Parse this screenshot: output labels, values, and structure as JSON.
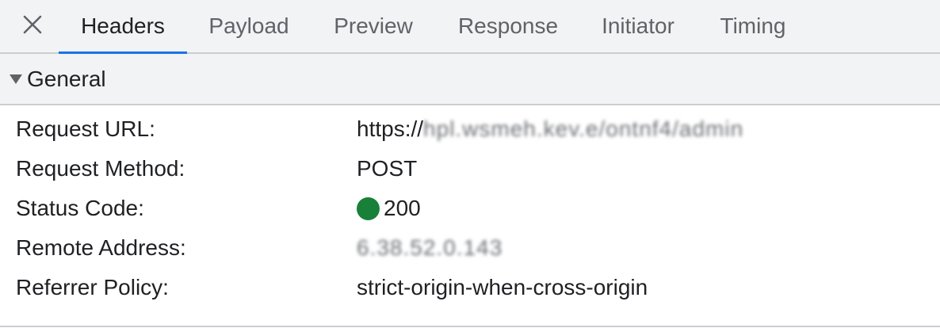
{
  "tabs": [
    {
      "label": "Headers",
      "active": true
    },
    {
      "label": "Payload",
      "active": false
    },
    {
      "label": "Preview",
      "active": false
    },
    {
      "label": "Response",
      "active": false
    },
    {
      "label": "Initiator",
      "active": false
    },
    {
      "label": "Timing",
      "active": false
    }
  ],
  "close_icon": "close-icon",
  "section": {
    "title": "General",
    "expanded": true,
    "toggle_icon": "triangle-down-icon"
  },
  "rows": [
    {
      "label": "Request URL:",
      "value_prefix": "https://",
      "value_obscured": "hpl.wsmeh.kev.e/ontnf4/admin"
    },
    {
      "label": "Request Method:",
      "value": "POST"
    },
    {
      "label": "Status Code:",
      "value": "200",
      "status_color": "#188038"
    },
    {
      "label": "Remote Address:",
      "value_obscured": "6.38.52.0.143"
    },
    {
      "label": "Referrer Policy:",
      "value": "strict-origin-when-cross-origin"
    }
  ],
  "colors": {
    "accent": "#1a73e8",
    "status_ok": "#188038"
  }
}
